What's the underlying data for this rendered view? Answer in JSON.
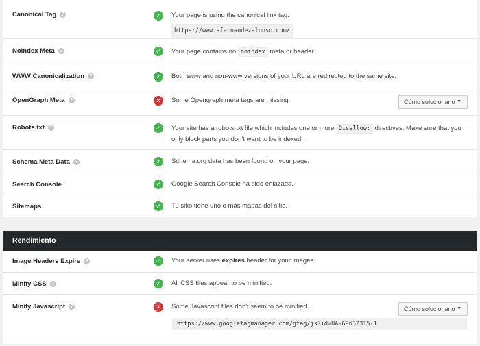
{
  "rows_top": [
    {
      "label": "Canonical Tag",
      "status": "ok",
      "text": "Your page is using the canonical link tag.",
      "code": "https://www.afernandezalonso.com/"
    },
    {
      "label": "Noindex Meta",
      "status": "ok",
      "text_before": "Your page contains no",
      "code": "noindex",
      "text_after": "meta or header."
    },
    {
      "label": "WWW Canonicalization",
      "status": "ok",
      "text": "Both www and non-www versions of your URL are redirected to the same site."
    },
    {
      "label": "OpenGraph Meta",
      "status": "bad",
      "text": "Some Opengraph meta tags are missing.",
      "button": "Cómo solucionarlo"
    },
    {
      "label": "Robots.txt",
      "status": "ok",
      "text_before": "Your site has a robots.txt file which includes one or more",
      "code": "Disallow:",
      "text_after": "directives. Make sure that you only block parts you don't want to be indexed."
    },
    {
      "label": "Schema Meta Data",
      "status": "ok",
      "text": "Schema.org data has been found on your page."
    },
    {
      "label": "Search Console",
      "status": "ok",
      "text": "Google Search Console ha sido enlazada."
    },
    {
      "label": "Sitemaps",
      "status": "ok",
      "text": "Tu sitio tiene uno o más mapas del sitio."
    }
  ],
  "section_title": "Rendimiento",
  "rows_perf": [
    {
      "label": "Image Headers Expire",
      "status": "ok",
      "text_before": "Your server uses",
      "bold": "expires",
      "text_after": "header for your images."
    },
    {
      "label": "Minify CSS",
      "status": "ok",
      "text": "All CSS files appear to be minified."
    },
    {
      "label": "Minify Javascript",
      "status": "bad",
      "text": "Some Javascript files don't seem to be minified.",
      "button": "Cómo solucionarlo",
      "code": "https://www.googletagmanager.com/gtag/js?id=UA-69632315-1"
    }
  ],
  "icons": {
    "ok": "check-icon",
    "bad": "cross-icon",
    "help": "question-icon",
    "caret": "caret-down-icon"
  },
  "colors": {
    "ok": "#46b450",
    "bad": "#dc3232",
    "header_bg": "#23282d"
  }
}
